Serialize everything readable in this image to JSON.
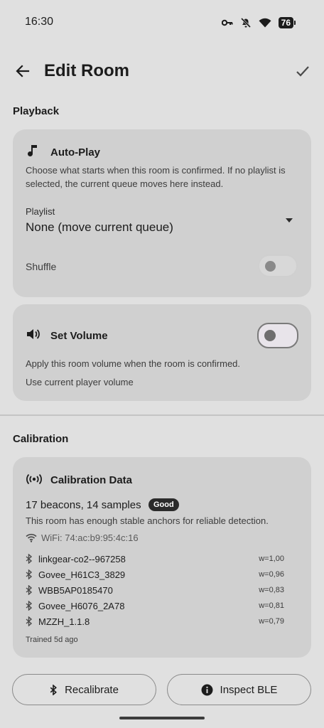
{
  "status": {
    "time": "16:30",
    "battery": "76"
  },
  "header": {
    "title": "Edit Room"
  },
  "playback": {
    "section_title": "Playback",
    "autoplay": {
      "title": "Auto-Play",
      "description": "Choose what starts when this room is confirmed. If no playlist is selected, the current queue moves here instead.",
      "playlist_label": "Playlist",
      "playlist_value": "None (move current queue)",
      "shuffle_label": "Shuffle",
      "shuffle_on": false
    },
    "volume": {
      "title": "Set Volume",
      "enabled": false,
      "description": "Apply this room volume when the room is confirmed.",
      "mode": "Use current player volume"
    }
  },
  "calibration": {
    "section_title": "Calibration",
    "card_title": "Calibration Data",
    "summary": "17 beacons, 14 samples",
    "quality_badge": "Good",
    "description": "This room has enough stable anchors for reliable detection.",
    "wifi": "WiFi: 74:ac:b9:95:4c:16",
    "beacons": [
      {
        "name": "linkgear-co2--967258",
        "weight": "w=1,00"
      },
      {
        "name": "Govee_H61C3_3829",
        "weight": "w=0,96"
      },
      {
        "name": "WBB5AP0185470",
        "weight": "w=0,83"
      },
      {
        "name": "Govee_H6076_2A78",
        "weight": "w=0,81"
      },
      {
        "name": "MZZH_1.1.8",
        "weight": "w=0,79"
      }
    ],
    "trained": "Trained 5d ago"
  },
  "actions": {
    "recalibrate": "Recalibrate",
    "inspect": "Inspect BLE"
  }
}
